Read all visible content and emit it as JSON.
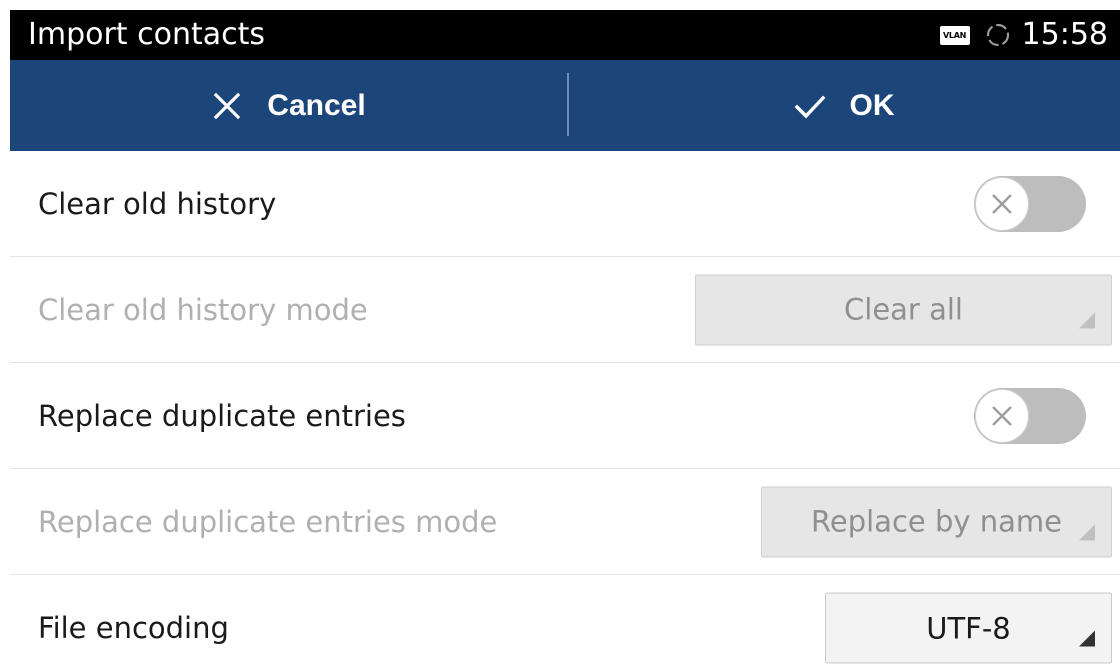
{
  "status_bar": {
    "title": "Import contacts",
    "vlan_badge": "VLAN",
    "time": "15:58",
    "icons": [
      "vlan-icon",
      "sync-icon"
    ]
  },
  "action_bar": {
    "cancel_label": "Cancel",
    "ok_label": "OK",
    "background_color": "#1c4679",
    "icons": [
      "close-icon",
      "checkmark-icon"
    ]
  },
  "settings": {
    "clear_old_history": {
      "label": "Clear old history",
      "enabled": false
    },
    "clear_old_history_mode": {
      "label": "Clear old history mode",
      "value": "Clear all",
      "disabled": true
    },
    "replace_duplicate_entries": {
      "label": "Replace duplicate entries",
      "enabled": false
    },
    "replace_duplicate_entries_mode": {
      "label": "Replace duplicate entries mode",
      "value": "Replace by name",
      "disabled": true
    },
    "file_encoding": {
      "label": "File encoding",
      "value": "UTF-8",
      "disabled": false
    }
  }
}
